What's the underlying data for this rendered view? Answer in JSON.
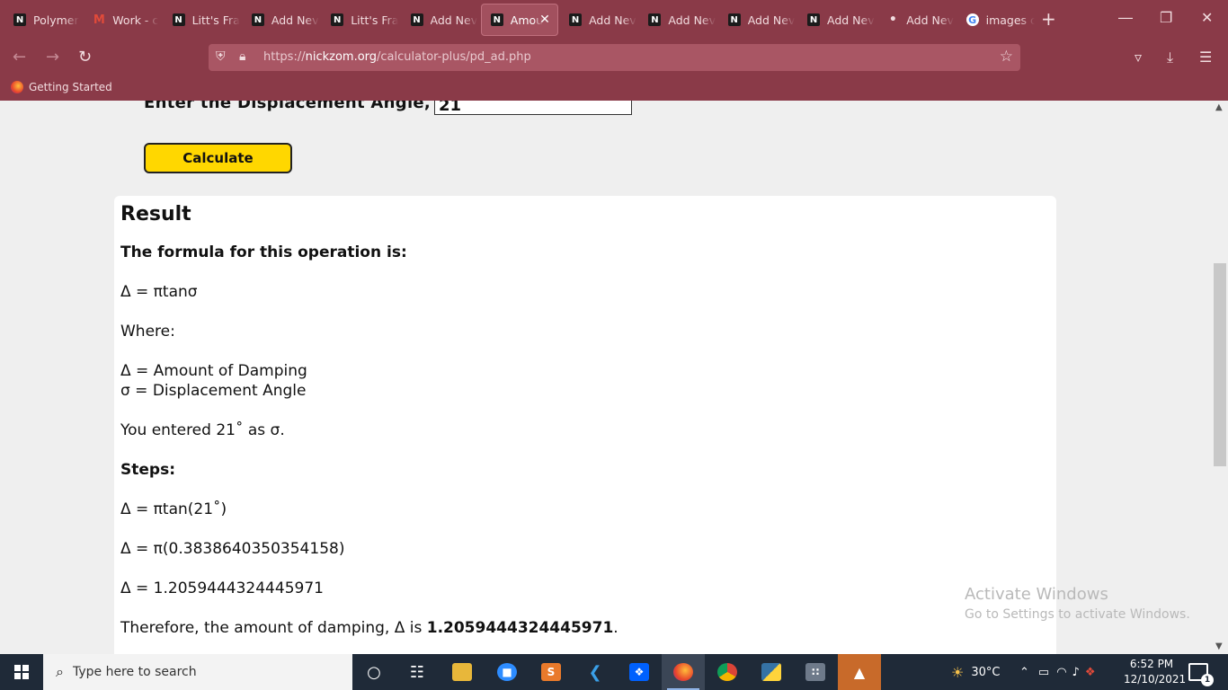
{
  "browser": {
    "tabs": [
      {
        "title": "Polymer",
        "favicon": "nickzom-icon",
        "active": false
      },
      {
        "title": "Work - c",
        "favicon": "gmail-icon",
        "active": false
      },
      {
        "title": "Litt's Fra",
        "favicon": "nickzom-icon",
        "active": false
      },
      {
        "title": "Add Nev",
        "favicon": "nickzom-icon",
        "active": false
      },
      {
        "title": "Litt's Fra",
        "favicon": "nickzom-icon",
        "active": false
      },
      {
        "title": "Add Nev",
        "favicon": "nickzom-icon",
        "active": false
      },
      {
        "title": "Amou",
        "favicon": "nickzom-icon",
        "active": true
      },
      {
        "title": "Add Nev",
        "favicon": "nickzom-icon",
        "active": false
      },
      {
        "title": "Add Nev",
        "favicon": "nickzom-icon",
        "active": false
      },
      {
        "title": "Add Nev",
        "favicon": "nickzom-icon",
        "active": false
      },
      {
        "title": "Add Nev",
        "favicon": "nickzom-icon",
        "active": false
      },
      {
        "title": "Add Nev",
        "favicon": "dot-icon",
        "active": false
      },
      {
        "title": "images c",
        "favicon": "google-icon",
        "active": false
      }
    ],
    "url_host": "nickzom.org",
    "url_prefix": "https://",
    "url_path": "/calculator-plus/pd_ad.php",
    "bookmark": "Getting Started",
    "theme_color": "#8a3a48"
  },
  "page": {
    "angle_label": "Enter the Displacement Angle, σ:",
    "angle_value": "21",
    "calculate_label": "Calculate",
    "result_title": "Result",
    "formula_intro": "The formula for this operation is:",
    "formula": "Δ = πtanσ",
    "where_label": "Where:",
    "def_delta": "Δ = Amount of Damping",
    "def_sigma": "σ = Displacement Angle",
    "entered": "You entered 21˚ as σ.",
    "steps_label": "Steps:",
    "step1": "Δ = πtan(21˚)",
    "step2": "Δ = π(0.3838640350354158)",
    "step3": "Δ = 1.2059444324445971",
    "conclusion_text": "Therefore, the amount of damping, Δ is ",
    "conclusion_value": "1.2059444324445971",
    "conclusion_end": "."
  },
  "watermark": {
    "line1": "Activate Windows",
    "line2": "Go to Settings to activate Windows."
  },
  "taskbar": {
    "search_placeholder": "Type here to search",
    "weather": "30°C",
    "time": "6:52 PM",
    "date": "12/10/2021",
    "notification_count": "1"
  }
}
